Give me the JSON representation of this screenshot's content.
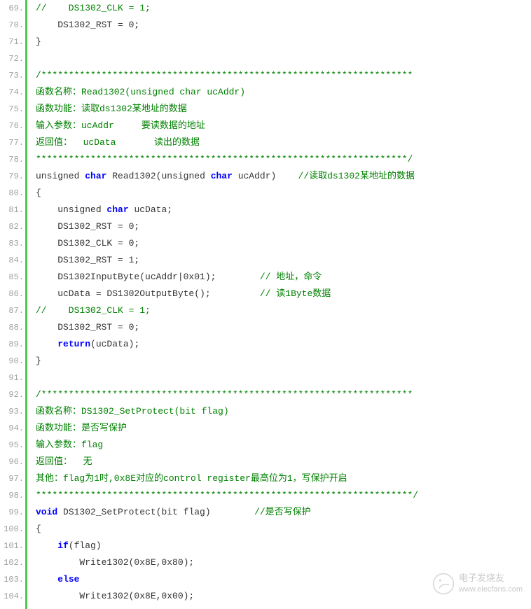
{
  "startLine": 69,
  "watermark": {
    "cn": "电子发烧友",
    "url": "www.elecfans.com"
  },
  "lines": [
    {
      "n": 69,
      "tokens": [
        {
          "t": "//    DS1302_CLK = 1;",
          "c": "comment"
        }
      ]
    },
    {
      "n": 70,
      "tokens": [
        {
          "t": "    DS1302_RST = 0;",
          "c": ""
        }
      ]
    },
    {
      "n": 71,
      "tokens": [
        {
          "t": "}",
          "c": ""
        }
      ]
    },
    {
      "n": 72,
      "tokens": []
    },
    {
      "n": 73,
      "tokens": [
        {
          "t": "/********************************************************************",
          "c": "comment"
        }
      ]
    },
    {
      "n": 74,
      "tokens": [
        {
          "t": "函数名称：Read1302(unsigned char ucAddr)",
          "c": "comment"
        }
      ]
    },
    {
      "n": 75,
      "tokens": [
        {
          "t": "函数功能：读取ds1302某地址的数据",
          "c": "comment"
        }
      ]
    },
    {
      "n": 76,
      "tokens": [
        {
          "t": "输入参数：ucAddr     要读数据的地址",
          "c": "comment"
        }
      ]
    },
    {
      "n": 77,
      "tokens": [
        {
          "t": "返回值：  ucData       读出的数据",
          "c": "comment"
        }
      ]
    },
    {
      "n": 78,
      "tokens": [
        {
          "t": "********************************************************************/",
          "c": "comment"
        }
      ]
    },
    {
      "n": 79,
      "tokens": [
        {
          "t": "unsigned",
          "c": ""
        },
        {
          "t": " ",
          "c": ""
        },
        {
          "t": "char",
          "c": "keyword"
        },
        {
          "t": " Read1302(unsigned ",
          "c": ""
        },
        {
          "t": "char",
          "c": "keyword"
        },
        {
          "t": " ucAddr)    ",
          "c": ""
        },
        {
          "t": "//读取ds1302某地址的数据",
          "c": "comment"
        }
      ]
    },
    {
      "n": 80,
      "tokens": [
        {
          "t": "{",
          "c": ""
        }
      ]
    },
    {
      "n": 81,
      "tokens": [
        {
          "t": "    unsigned ",
          "c": ""
        },
        {
          "t": "char",
          "c": "keyword"
        },
        {
          "t": " ucData;",
          "c": ""
        }
      ]
    },
    {
      "n": 82,
      "tokens": [
        {
          "t": "    DS1302_RST = 0;",
          "c": ""
        }
      ]
    },
    {
      "n": 83,
      "tokens": [
        {
          "t": "    DS1302_CLK = 0;",
          "c": ""
        }
      ]
    },
    {
      "n": 84,
      "tokens": [
        {
          "t": "    DS1302_RST = 1;",
          "c": ""
        }
      ]
    },
    {
      "n": 85,
      "tokens": [
        {
          "t": "    DS1302InputByte(ucAddr|0x01);        ",
          "c": ""
        },
        {
          "t": "// 地址，命令",
          "c": "comment"
        }
      ]
    },
    {
      "n": 86,
      "tokens": [
        {
          "t": "    ucData = DS1302OutputByte();         ",
          "c": ""
        },
        {
          "t": "// 读1Byte数据",
          "c": "comment"
        }
      ]
    },
    {
      "n": 87,
      "tokens": [
        {
          "t": "//    DS1302_CLK = 1;",
          "c": "comment"
        }
      ]
    },
    {
      "n": 88,
      "tokens": [
        {
          "t": "    DS1302_RST = 0;",
          "c": ""
        }
      ]
    },
    {
      "n": 89,
      "tokens": [
        {
          "t": "    ",
          "c": ""
        },
        {
          "t": "return",
          "c": "keyword"
        },
        {
          "t": "(ucData);",
          "c": ""
        }
      ]
    },
    {
      "n": 90,
      "tokens": [
        {
          "t": "}",
          "c": ""
        }
      ]
    },
    {
      "n": 91,
      "tokens": []
    },
    {
      "n": 92,
      "tokens": [
        {
          "t": "/********************************************************************",
          "c": "comment"
        }
      ]
    },
    {
      "n": 93,
      "tokens": [
        {
          "t": "函数名称：DS1302_SetProtect(bit flag)",
          "c": "comment"
        }
      ]
    },
    {
      "n": 94,
      "tokens": [
        {
          "t": "函数功能：是否写保护",
          "c": "comment"
        }
      ]
    },
    {
      "n": 95,
      "tokens": [
        {
          "t": "输入参数：flag",
          "c": "comment"
        }
      ]
    },
    {
      "n": 96,
      "tokens": [
        {
          "t": "返回值：  无",
          "c": "comment"
        }
      ]
    },
    {
      "n": 97,
      "tokens": [
        {
          "t": "其他：flag为1时,0x8E对应的control register最高位为1，写保护开启",
          "c": "comment"
        }
      ]
    },
    {
      "n": 98,
      "tokens": [
        {
          "t": "*********************************************************************/",
          "c": "comment"
        }
      ]
    },
    {
      "n": 99,
      "tokens": [
        {
          "t": "void",
          "c": "keyword"
        },
        {
          "t": " DS1302_SetProtect(bit flag)        ",
          "c": ""
        },
        {
          "t": "//是否写保护",
          "c": "comment"
        }
      ]
    },
    {
      "n": 100,
      "tokens": [
        {
          "t": "{",
          "c": ""
        }
      ]
    },
    {
      "n": 101,
      "tokens": [
        {
          "t": "    ",
          "c": ""
        },
        {
          "t": "if",
          "c": "keyword"
        },
        {
          "t": "(flag)",
          "c": ""
        }
      ]
    },
    {
      "n": 102,
      "tokens": [
        {
          "t": "        Write1302(0x8E,0x80);",
          "c": ""
        }
      ]
    },
    {
      "n": 103,
      "tokens": [
        {
          "t": "    ",
          "c": ""
        },
        {
          "t": "else",
          "c": "keyword"
        }
      ]
    },
    {
      "n": 104,
      "tokens": [
        {
          "t": "        Write1302(0x8E,0x00);",
          "c": ""
        }
      ]
    }
  ]
}
